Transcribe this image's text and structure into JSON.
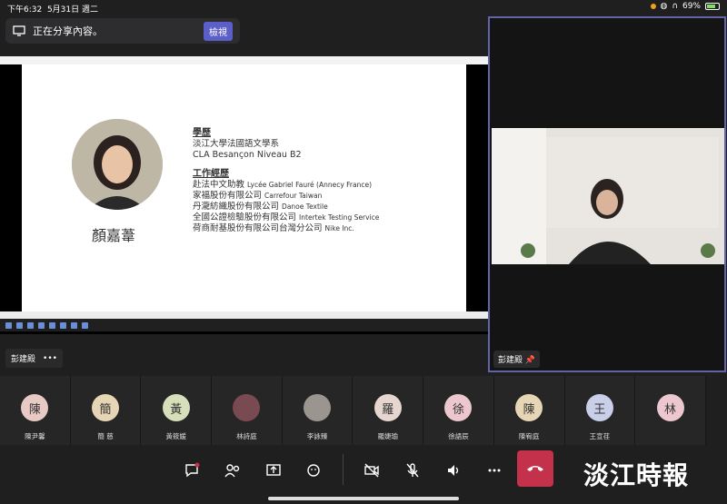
{
  "status_bar": {
    "time": "下午6:32",
    "date": "5月31日 週二",
    "battery": "69%"
  },
  "share_banner": {
    "text": "正在分享內容。",
    "view_label": "檢視"
  },
  "slide": {
    "name": "顏嘉葦",
    "education_heading": "學歷",
    "education": [
      "淡江大學法國語文學系",
      "CLA Besançon Niveau B2"
    ],
    "work_heading": "工作經歷",
    "work": [
      {
        "zh": "赴法中文助教",
        "en": "Lycée Gabriel Fauré (Annecy France)"
      },
      {
        "zh": "家福股份有限公司",
        "en": "Carrefour Taiwan"
      },
      {
        "zh": "丹瀧紡織股份有限公司",
        "en": "Danoe Textile"
      },
      {
        "zh": "全國公證檢驗股份有限公司",
        "en": "Intertek Testing Service"
      },
      {
        "zh": "荷商耐基股份有限公司台灣分公司",
        "en": "Nike Inc."
      }
    ]
  },
  "stage_presenter": "彭建殿",
  "main_tile_name": "彭建殿",
  "participants": [
    {
      "initial": "陳",
      "name": "陳尹馨",
      "color": "#e8c9c4"
    },
    {
      "initial": "簡",
      "name": "簡 慈",
      "color": "#e7d6b5"
    },
    {
      "initial": "黃",
      "name": "黃筱媛",
      "color": "#d6dfb9"
    },
    {
      "initial": "",
      "name": "林詩庭",
      "color": "#7a4a52"
    },
    {
      "initial": "",
      "name": "李詠臻",
      "color": "#9a968f"
    },
    {
      "initial": "羅",
      "name": "羅婕瑜",
      "color": "#e5d6cf"
    },
    {
      "initial": "徐",
      "name": "徐語辰",
      "color": "#ecc7cf"
    },
    {
      "initial": "陳",
      "name": "陳宥庭",
      "color": "#e7d6b5"
    },
    {
      "initial": "王",
      "name": "王宣荏",
      "color": "#c9cfe8"
    },
    {
      "initial": "林",
      "name": "",
      "color": "#ecc7cf"
    }
  ],
  "controls": {
    "icons": [
      "chat-icon",
      "people-icon",
      "share-icon",
      "reactions-icon",
      "camera-off-icon",
      "mic-off-icon",
      "speaker-icon",
      "more-icon",
      "hang-up-icon"
    ]
  },
  "watermark": "淡江時報"
}
